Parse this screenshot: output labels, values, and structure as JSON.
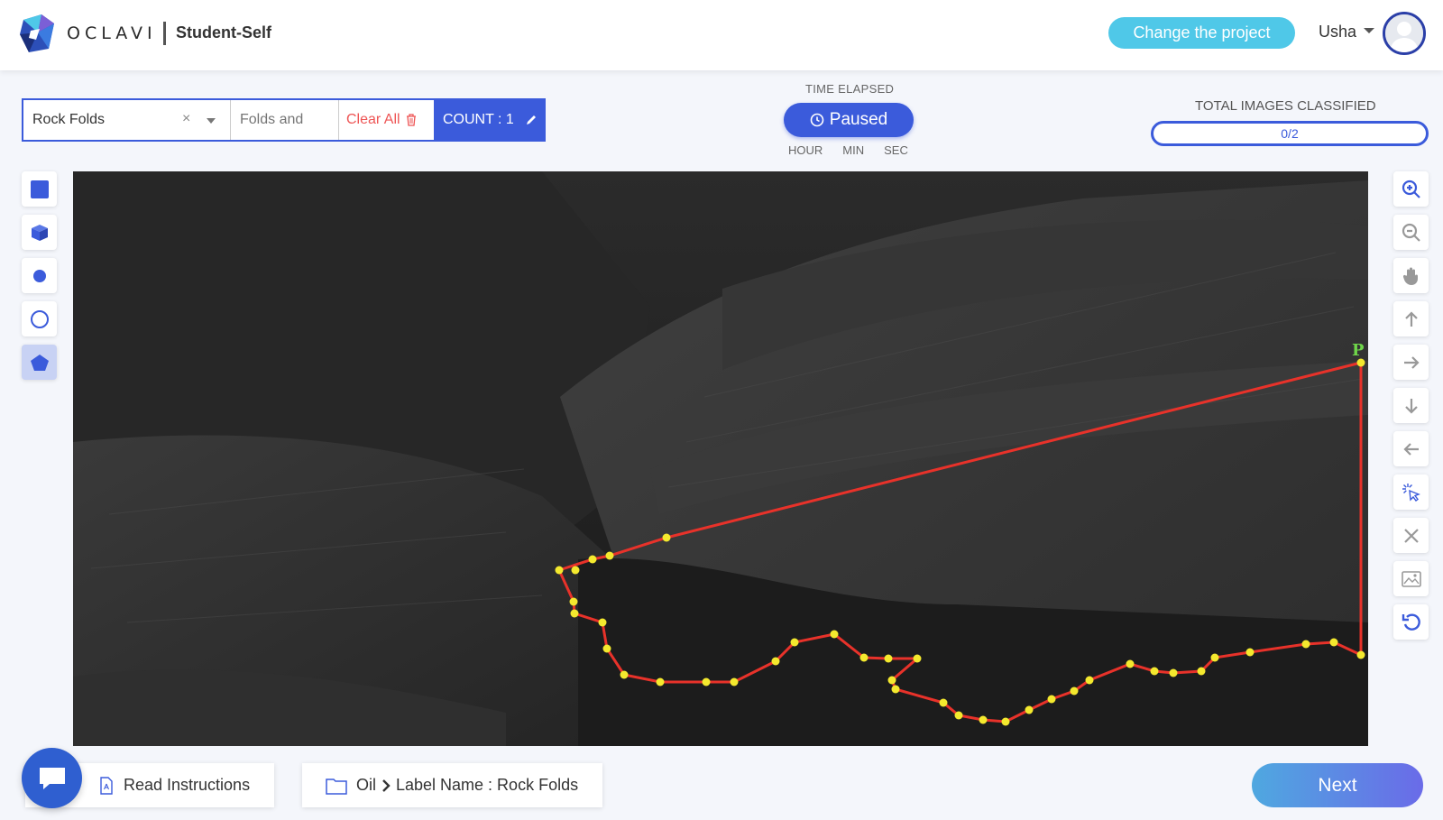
{
  "header": {
    "brand": "OCLAVI",
    "project_name": "Student-Self",
    "change_project_label": "Change the project",
    "user_name": "Usha"
  },
  "label_bar": {
    "selected_label": "Rock Folds",
    "sub_label_placeholder": "Folds and",
    "clear_all_label": "Clear All",
    "count_label": "COUNT : 1"
  },
  "timer": {
    "title": "TIME ELAPSED",
    "state_label": "Paused",
    "units": [
      "HOUR",
      "MIN",
      "SEC"
    ]
  },
  "progress": {
    "title": "TOTAL IMAGES CLASSIFIED",
    "value_text": "0/2",
    "fraction": 0
  },
  "left_tools": [
    {
      "name": "rectangle-tool",
      "icon": "square-icon"
    },
    {
      "name": "cuboid-tool",
      "icon": "cube-icon"
    },
    {
      "name": "point-tool",
      "icon": "dot-icon"
    },
    {
      "name": "circle-tool",
      "icon": "circle-icon"
    },
    {
      "name": "polygon-tool",
      "icon": "pentagon-icon",
      "active": true
    }
  ],
  "right_tools": [
    {
      "name": "zoom-in-button",
      "icon": "zoom-in-icon"
    },
    {
      "name": "zoom-out-button",
      "icon": "zoom-out-icon"
    },
    {
      "name": "pan-button",
      "icon": "hand-icon"
    },
    {
      "name": "move-up-button",
      "icon": "arrow-up-icon"
    },
    {
      "name": "move-right-button",
      "icon": "arrow-right-icon"
    },
    {
      "name": "move-down-button",
      "icon": "arrow-down-icon"
    },
    {
      "name": "move-left-button",
      "icon": "arrow-left-icon"
    },
    {
      "name": "select-button",
      "icon": "cursor-click-icon"
    },
    {
      "name": "delete-button",
      "icon": "close-icon"
    },
    {
      "name": "image-button",
      "icon": "image-icon"
    },
    {
      "name": "undo-button",
      "icon": "undo-icon"
    }
  ],
  "annotation": {
    "polygon_label": "P",
    "line_color": "#e8322a",
    "vertex_color": "#f4e92e",
    "label_color": "#6fd64a"
  },
  "bottom": {
    "read_instructions_label": "Read Instructions",
    "breadcrumb_root": "Oil",
    "breadcrumb_leaf": "Label Name : Rock Folds",
    "next_label": "Next"
  },
  "colors": {
    "accent": "#3b5bdb",
    "cyan": "#4fc8e8",
    "danger": "#e55555"
  }
}
